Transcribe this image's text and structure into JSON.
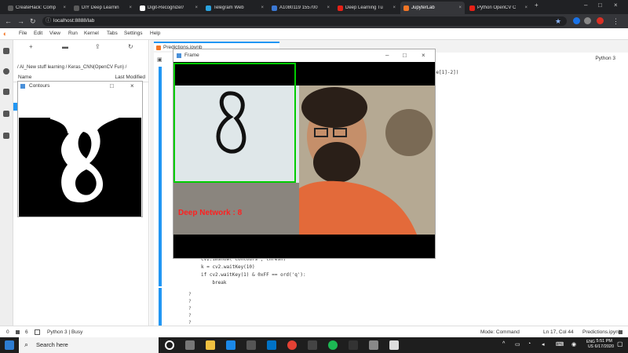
{
  "browser": {
    "tabs": [
      {
        "title": "CreateHack: Comp",
        "color": "#5a5a5a"
      },
      {
        "title": "DIY Deep Learnin",
        "color": "#5a5a5a"
      },
      {
        "title": "Digit-Recognizer/",
        "color": "#ffffff"
      },
      {
        "title": "Telegram Web",
        "color": "#2aa3df"
      },
      {
        "title": "A1080119 155700",
        "color": "#3b78d4"
      },
      {
        "title": "Deep Learning Tu",
        "color": "#e62117"
      },
      {
        "title": "JupyterLab",
        "color": "#f37626"
      },
      {
        "title": "Python OpenCV C",
        "color": "#e62117"
      }
    ],
    "new_tab": "+",
    "address": "localhost:8888/lab",
    "win_controls": [
      "–",
      "□",
      "×"
    ]
  },
  "jupyter": {
    "menu": [
      "File",
      "Edit",
      "View",
      "Run",
      "Kernel",
      "Tabs",
      "Settings",
      "Help"
    ],
    "breadcrumb": "/ AI_New stuff learning / Keras_CNN(OpenCV Fun) /",
    "col_name": "Name",
    "col_modified": "Last Modified",
    "doc_tab": "Predictions.ipynb",
    "kernel": "Python 3",
    "code_partial": "shape[1]-2])",
    "code_lines": [
      "cv2.imshow('Contours', thresh)",
      "k = cv2.waitKey(10)",
      "if cv2.waitKey(1) & 0xFF == ord('q'):",
      "    break"
    ],
    "output_marks": [
      "?",
      "?",
      "?",
      "?",
      "?"
    ],
    "status": {
      "left_a": "0",
      "left_b": "6",
      "kernel_state": "Python 3 | Busy",
      "mode": "Mode: Command",
      "cursor": "Ln 17, Col 44",
      "file": "Predictions.ipynb"
    }
  },
  "windows": {
    "contours_title": "Contours",
    "frame_title": "Frame",
    "prediction_label": "Deep Network :  8",
    "digit": "8"
  },
  "taskbar": {
    "search_placeholder": "Search here",
    "lang": "ENG",
    "region": "US",
    "time": "5:51 PM",
    "date": "6/17/2020"
  }
}
